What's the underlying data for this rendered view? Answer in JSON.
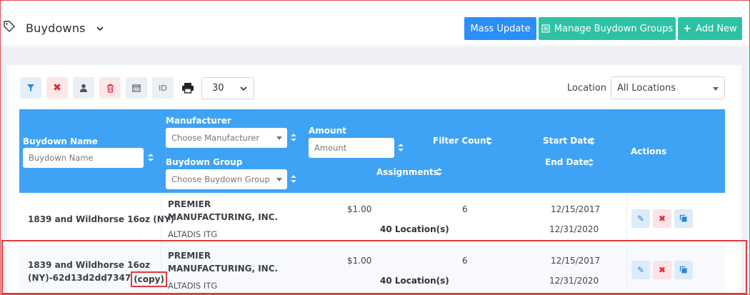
{
  "header": {
    "title": "Buydowns",
    "mass_update": "Mass Update",
    "manage_groups": "Manage Buydown Groups",
    "add_new": "Add New"
  },
  "toolbar": {
    "id_label": "ID",
    "page_size": "30",
    "location_label": "Location",
    "location_value": "All Locations"
  },
  "columns": {
    "name": "Buydown Name",
    "name_placeholder": "Buydown Name",
    "manufacturer": "Manufacturer",
    "manufacturer_placeholder": "Choose Manufacturer",
    "group": "Buydown Group",
    "group_placeholder": "Choose Buydown Group",
    "amount": "Amount",
    "amount_placeholder": "Amount",
    "filter_count": "Filter Count",
    "assignments": "Assignments",
    "start_date": "Start Date",
    "end_date": "End Date",
    "actions": "Actions"
  },
  "rows": [
    {
      "name": "1839 and Wildhorse 16oz (NY)",
      "manufacturer": "PREMIER MANUFACTURING, INC.",
      "group": "ALTADIS ITG",
      "amount": "$1.00",
      "filter_count": "6",
      "assignments": "40 Location(s)",
      "start_date": "12/15/2017",
      "end_date": "12/31/2020"
    },
    {
      "name_line1": "1839 and Wildhorse 16oz",
      "name_line2": "(NY)-62d13d2dd7347",
      "name_suffix": "(copy)",
      "manufacturer": "PREMIER MANUFACTURING, INC.",
      "group": "ALTADIS ITG",
      "amount": "$1.00",
      "filter_count": "6",
      "assignments": "40 Location(s)",
      "start_date": "12/15/2017",
      "end_date": "12/31/2020"
    }
  ],
  "colors": {
    "primary": "#2c8ef8",
    "success": "#2ec2a4",
    "table_header": "#3ea3f5",
    "highlight": "#e23b3b"
  },
  "icons": [
    "tag-icon",
    "chevron-down-icon",
    "list-icon",
    "plus-icon",
    "filter-icon",
    "clear-icon",
    "user-icon",
    "trash-icon",
    "calendar-icon",
    "print-icon",
    "edit-icon",
    "delete-icon",
    "copy-icon"
  ]
}
